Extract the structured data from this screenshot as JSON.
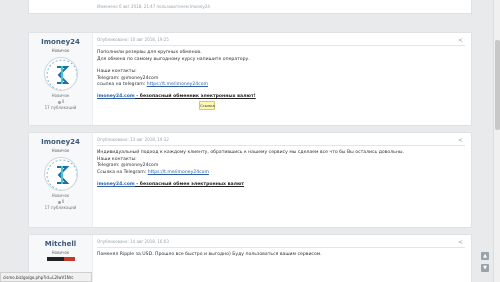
{
  "top": {
    "edited_text": "Изменено 6 авг 2018, 21:47 пользователем Imoney24"
  },
  "posts": [
    {
      "author": "Imoney24",
      "role": "Новичок",
      "rank": "Новичок",
      "count": "0",
      "posts": "17 публикаций",
      "date": "Опубликовано: 10 авг 2018, 19:25",
      "lines": [
        "Пополнили резервы для крупных обменов.",
        "Для обмена по самому выгодному курсу напишите оператору.",
        "",
        "Наши контакты:",
        "Telegram: @imoney24com"
      ],
      "link_label": "ссылка на telegram: ",
      "link": "https://t.me/imoney24com",
      "promo_link": "imoney24.com",
      "promo_tail": " - безопасный обменник электронных валют!"
    },
    {
      "author": "Imoney24",
      "role": "Новичок",
      "rank": "Новичок",
      "count": "0",
      "posts": "17 публикаций",
      "date": "Опубликовано: 13 авг 2018, 19:32",
      "lines": [
        "Индивидуальный подход к каждому клиенту, обратившись к нашему сервису мы сделаем все что бы Вы остались довольны.",
        "Наши контакты:",
        "Telegram: @imoney24com"
      ],
      "link_label": "Ссылка на Telegram: ",
      "link": "https://t.me/imoney24com",
      "promo_link": "imoney24.com",
      "promo_tail": " - безопасный обмен электронных валют"
    },
    {
      "author": "Mitchell",
      "role": "Новичок",
      "date": "Опубликовано: 14 авг 2018, 16:03",
      "lines": [
        "Поменял Ripple за USD. Прошло все быстро и выгодно) Буду пользоваться вашим сервисом."
      ]
    }
  ],
  "tooltip": "Ссылка",
  "statusbar": "cismo.biz/go/go.php?id=L2IwV1Nrc",
  "icons": {
    "share": "share-icon",
    "scroll_up": "arrow-up-icon",
    "scroll_down": "arrow-down-icon"
  }
}
